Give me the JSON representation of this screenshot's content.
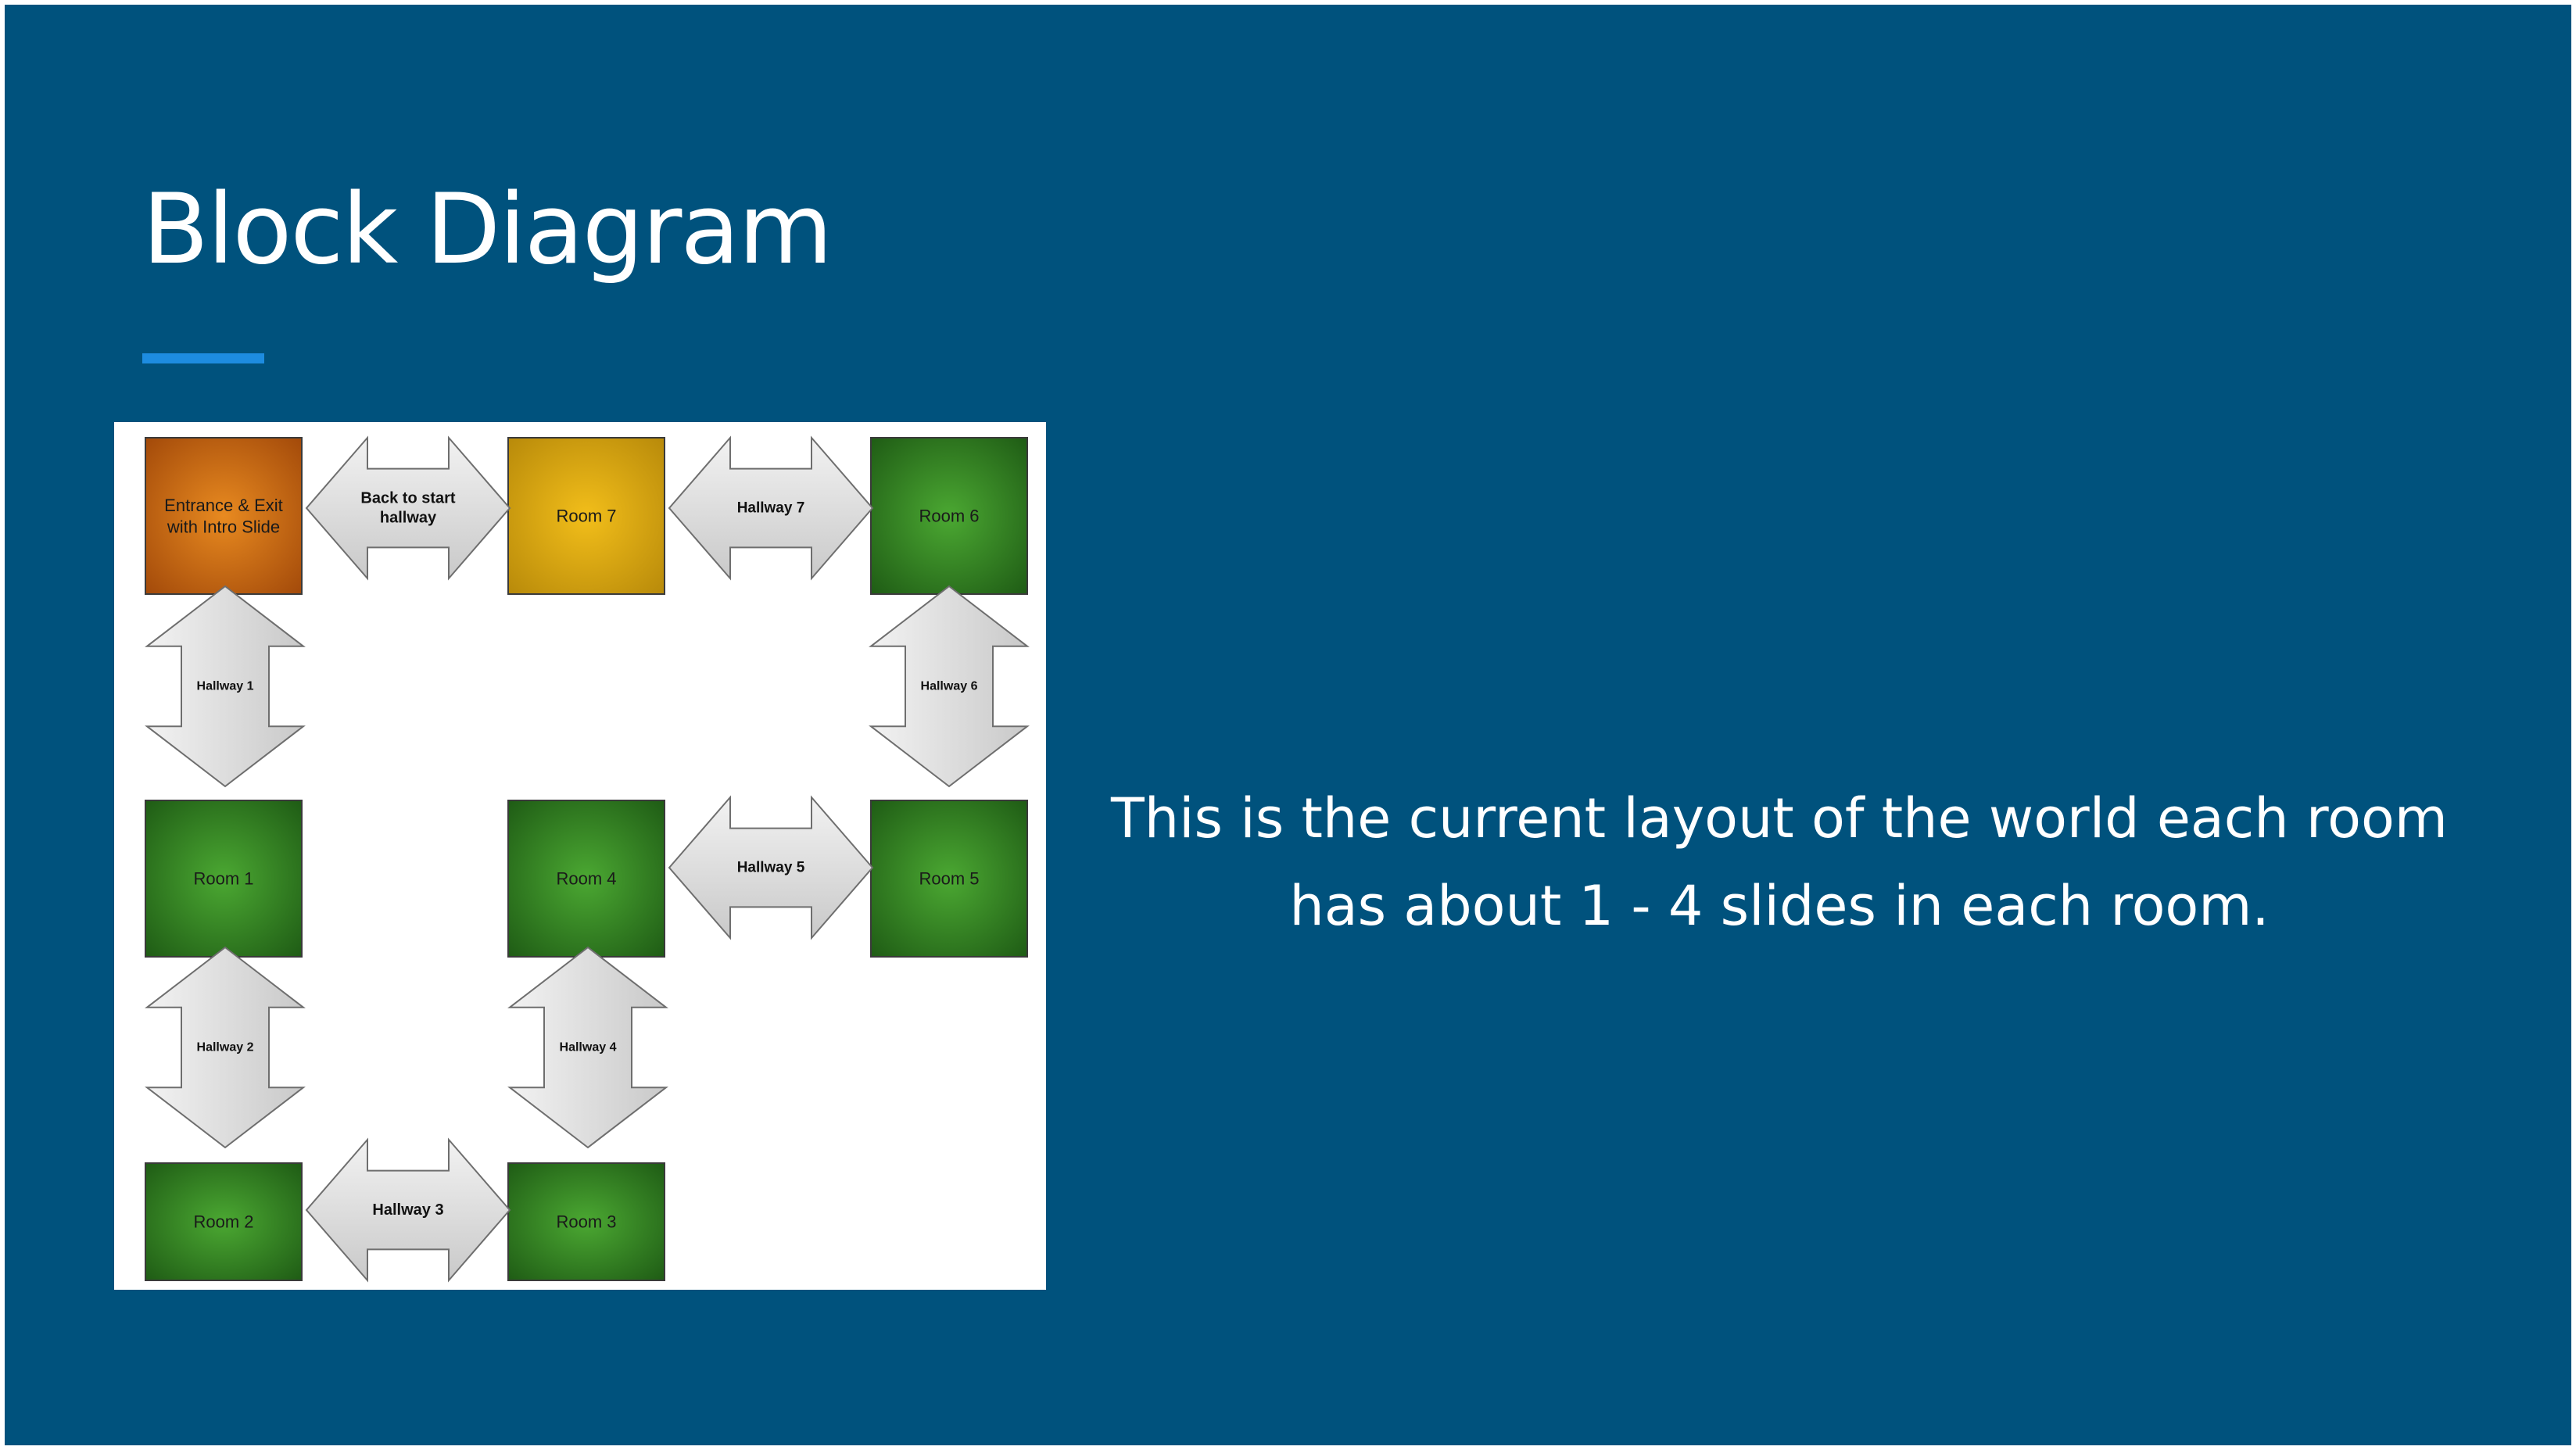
{
  "slide": {
    "title": "Block Diagram",
    "body_text": "This is the current layout of the world each room has about 1 - 4 slides in each room.",
    "colors": {
      "background": "#00527d",
      "title_underline": "#1d8ce0",
      "text": "#ffffff"
    }
  },
  "diagram": {
    "rooms": [
      {
        "id": "entrance",
        "lines": [
          "Entrance & Exit",
          "with Intro Slide"
        ],
        "color": "orange"
      },
      {
        "id": "room7",
        "lines": [
          "Room 7"
        ],
        "color": "gold"
      },
      {
        "id": "room6",
        "lines": [
          "Room 6"
        ],
        "color": "green"
      },
      {
        "id": "room1",
        "lines": [
          "Room 1"
        ],
        "color": "green"
      },
      {
        "id": "room4",
        "lines": [
          "Room 4"
        ],
        "color": "green"
      },
      {
        "id": "room5",
        "lines": [
          "Room 5"
        ],
        "color": "green"
      },
      {
        "id": "room2",
        "lines": [
          "Room 2"
        ],
        "color": "green"
      },
      {
        "id": "room3",
        "lines": [
          "Room 3"
        ],
        "color": "green"
      }
    ],
    "hallways": [
      {
        "id": "back-to-start",
        "lines": [
          "Back to start",
          "hallway"
        ],
        "direction": "horizontal"
      },
      {
        "id": "hallway7",
        "lines": [
          "Hallway 7"
        ],
        "direction": "horizontal"
      },
      {
        "id": "hallway1",
        "lines": [
          "Hallway 1"
        ],
        "direction": "vertical"
      },
      {
        "id": "hallway6",
        "lines": [
          "Hallway 6"
        ],
        "direction": "vertical"
      },
      {
        "id": "hallway5",
        "lines": [
          "Hallway 5"
        ],
        "direction": "horizontal"
      },
      {
        "id": "hallway2",
        "lines": [
          "Hallway 2"
        ],
        "direction": "vertical"
      },
      {
        "id": "hallway4",
        "lines": [
          "Hallway 4"
        ],
        "direction": "vertical"
      },
      {
        "id": "hallway3",
        "lines": [
          "Hallway 3"
        ],
        "direction": "horizontal"
      }
    ]
  }
}
